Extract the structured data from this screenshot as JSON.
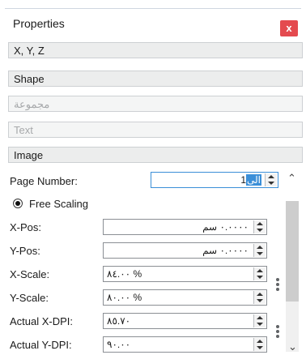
{
  "panel": {
    "title": "Properties",
    "close_label": "x"
  },
  "sections": [
    {
      "label": "X, Y, Z"
    },
    {
      "label": "Shape"
    },
    {
      "label": "مجموعة"
    },
    {
      "label": "Text"
    },
    {
      "label": "Image"
    }
  ],
  "page_number": {
    "label": "Page Number:",
    "value_prefix": "1",
    "value_selected": "الى"
  },
  "scaling": {
    "label": "Free Scaling",
    "selected": true
  },
  "fields": [
    {
      "label": "X-Pos:",
      "value": "٠.٠٠٠٠ سم"
    },
    {
      "label": "Y-Pos:",
      "value": "٠.٠٠٠٠ سم"
    },
    {
      "label": "X-Scale:",
      "value": "٨٤.٠٠ %"
    },
    {
      "label": "Y-Scale:",
      "value": "٨٠.٠٠ %"
    },
    {
      "label": "Actual X-DPI:",
      "value": "٨٥.٧٠"
    },
    {
      "label": "Actual Y-DPI:",
      "value": "٩٠.٠٠"
    }
  ],
  "colors": {
    "accent": "#3b8fd8",
    "close": "#e44a4f"
  }
}
